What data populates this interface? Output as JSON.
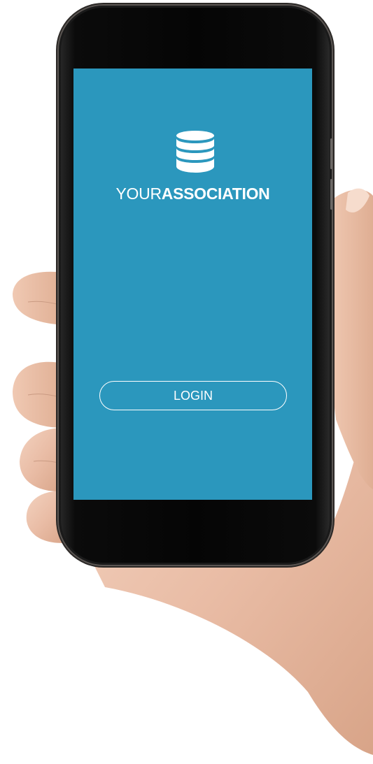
{
  "app": {
    "brand_light": "YOUR",
    "brand_bold": "ASSOCIATION",
    "logo_icon": "database-stack-icon",
    "accent_color": "#2b97bd"
  },
  "actions": {
    "login_label": "LOGIN"
  }
}
